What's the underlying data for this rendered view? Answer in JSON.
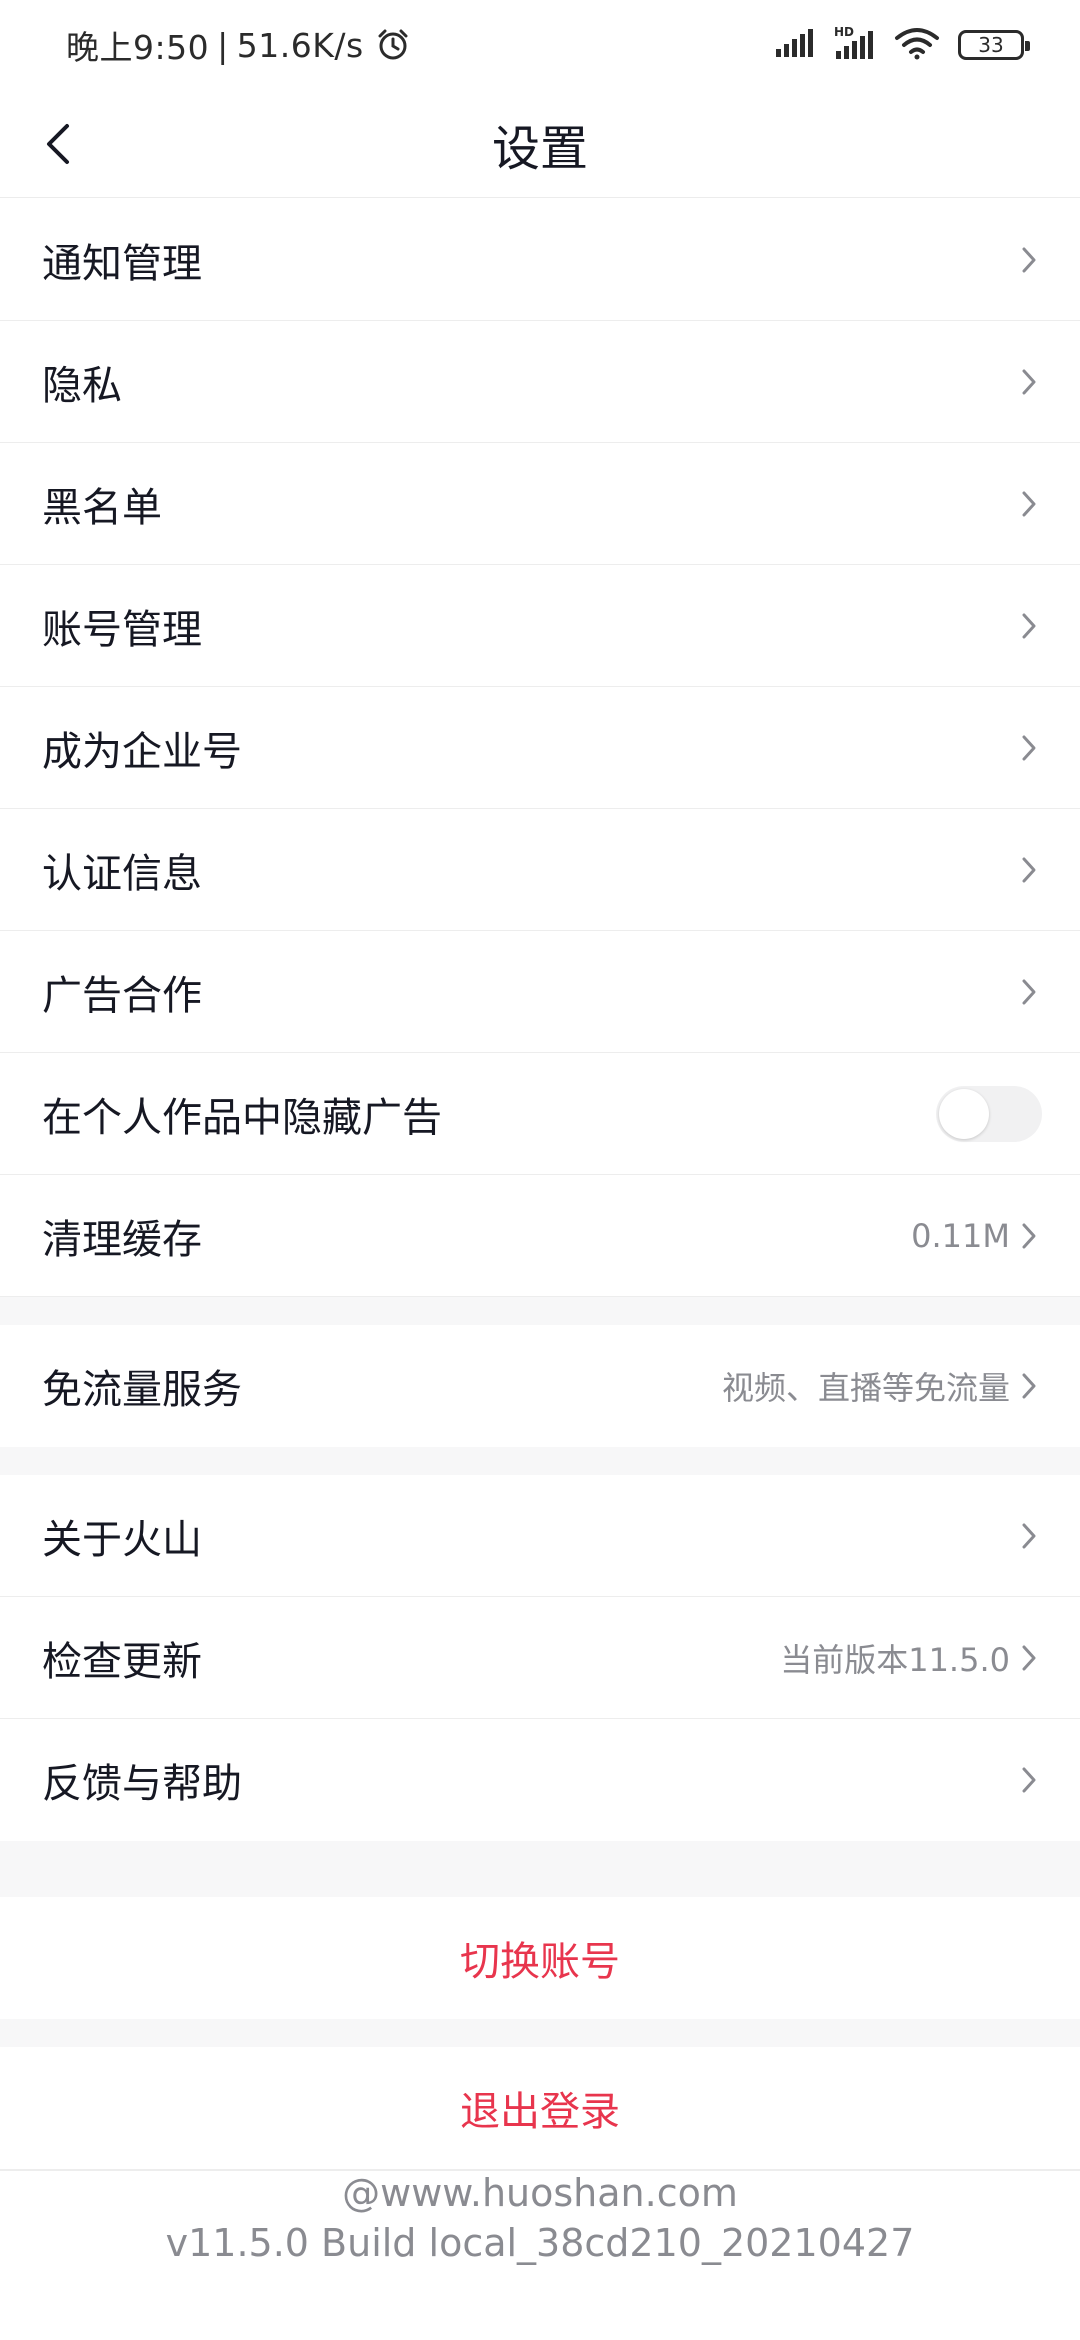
{
  "status_bar": {
    "time": "晚上9:50",
    "separator": "|",
    "speed": "51.6K/s",
    "alarm_icon": "alarm-clock-icon",
    "signal_icon": "cellular-signal-icon",
    "hd_signal_icon": "hd-signal-icon",
    "wifi_icon": "wifi-icon",
    "battery": "33"
  },
  "nav": {
    "back_icon": "chevron-left-icon",
    "title": "设置"
  },
  "group1": [
    {
      "label": "通知管理"
    },
    {
      "label": "隐私"
    },
    {
      "label": "黑名单"
    },
    {
      "label": "账号管理"
    },
    {
      "label": "成为企业号"
    },
    {
      "label": "认证信息"
    },
    {
      "label": "广告合作"
    }
  ],
  "hide_ads": {
    "label": "在个人作品中隐藏广告",
    "enabled": false
  },
  "clear_cache": {
    "label": "清理缓存",
    "value": "0.11M"
  },
  "free_data": {
    "label": "免流量服务",
    "value": "视频、直播等免流量"
  },
  "group3": {
    "about": {
      "label": "关于火山"
    },
    "update": {
      "label": "检查更新",
      "value": "当前版本11.5.0"
    },
    "feedback": {
      "label": "反馈与帮助"
    }
  },
  "actions": {
    "switch_account": "切换账号",
    "logout": "退出登录"
  },
  "footer": {
    "site": "@www.huoshan.com",
    "build": "v11.5.0 Build local_38cd210_20210427"
  },
  "colors": {
    "accent_red": "#e8354d",
    "text_primary": "#161823",
    "text_secondary": "#8a8b91",
    "divider_bg": "#f7f7f8"
  }
}
